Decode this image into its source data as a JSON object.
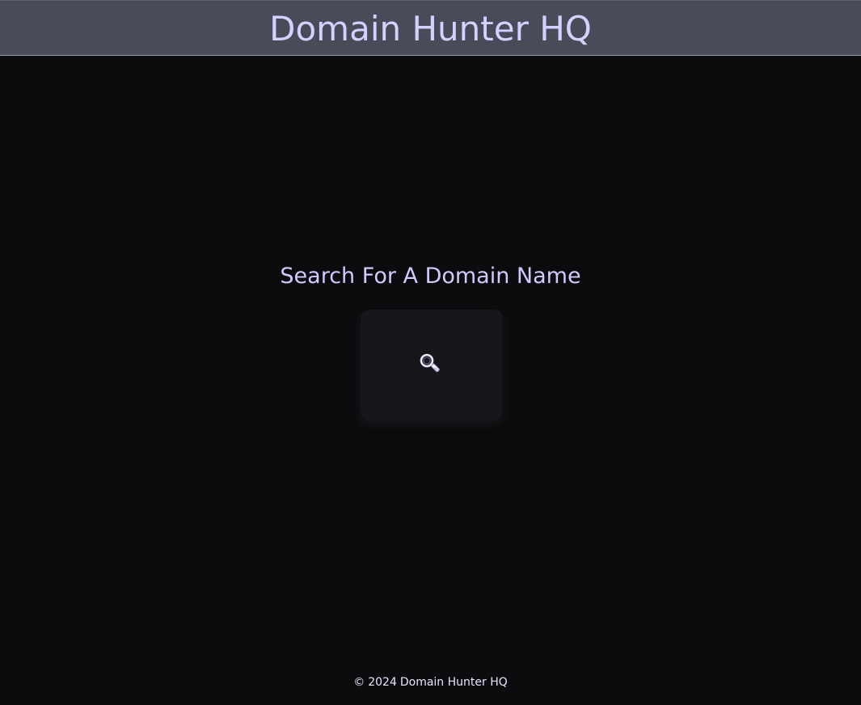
{
  "header": {
    "title": "Domain Hunter HQ"
  },
  "main": {
    "search_heading": "Search For A Domain Name",
    "search_tile": {
      "icon": "search-icon"
    }
  },
  "footer": {
    "copyright_symbol": "©",
    "year": "2024",
    "site_name": "Domain Hunter HQ"
  },
  "colors": {
    "page_background": "#0c0c0e",
    "header_background": "#4a4b59",
    "accent_text": "#cfcbff",
    "tile_background": "#17171b"
  }
}
